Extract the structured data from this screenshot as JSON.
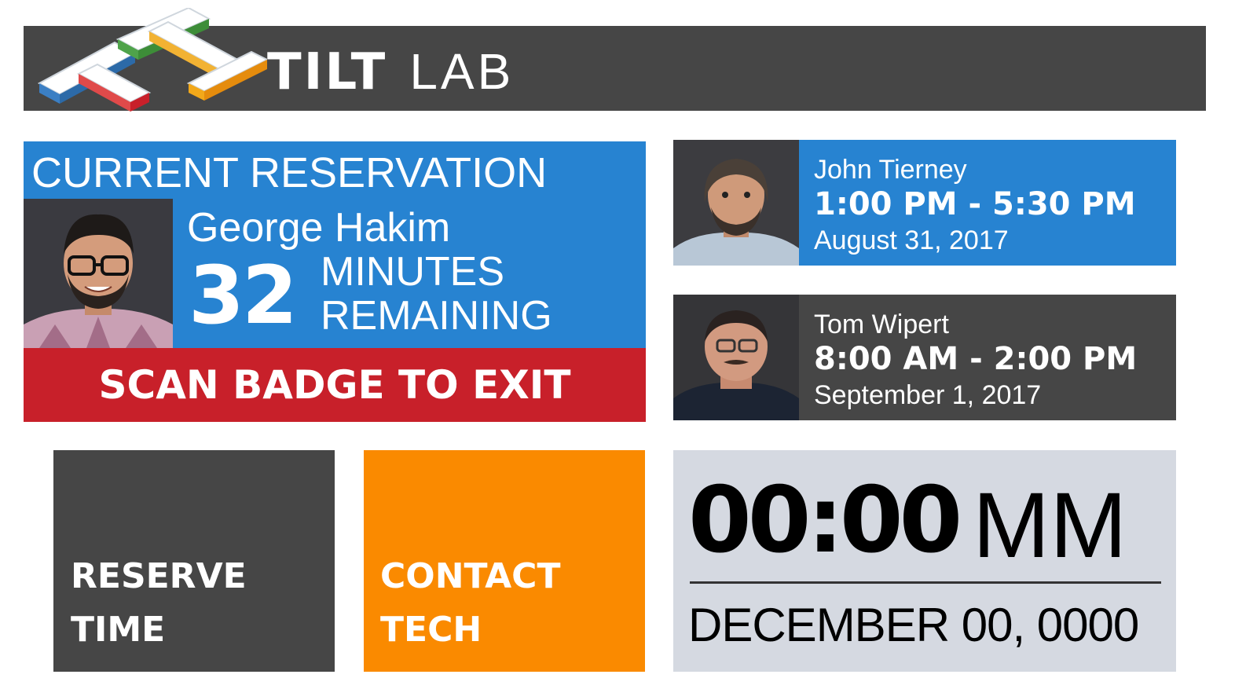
{
  "header": {
    "brand_bold": "TILT",
    "brand_light": "LAB",
    "logo": "tilt-lab-isometric-logo",
    "background": "#464646"
  },
  "current_reservation": {
    "label": "CURRENT RESERVATION",
    "name": "George Hakim",
    "minutes_remaining": "32",
    "minutes_line1": "MINUTES",
    "minutes_line2": "REMAINING",
    "exit_label": "SCAN BADGE TO EXIT",
    "colors": {
      "panel": "#2783d1",
      "exit_bar": "#c8202a"
    }
  },
  "upcoming": [
    {
      "name": "John Tierney",
      "time": "1:00 PM - 5:30 PM",
      "date": "August 31, 2017",
      "color": "#2783d1"
    },
    {
      "name": "Tom Wipert",
      "time": "8:00 AM - 2:00 PM",
      "date": "September 1, 2017",
      "color": "#464646"
    }
  ],
  "tiles": {
    "reserve": {
      "line1": "RESERVE",
      "line2": "TIME",
      "color": "#464646"
    },
    "contact": {
      "line1": "CONTACT",
      "line2": "TECH",
      "color": "#fa8a00"
    }
  },
  "clock": {
    "time": "00:00",
    "suffix": "MM",
    "date": "DECEMBER 00, 0000",
    "background": "#d5d9e1"
  }
}
